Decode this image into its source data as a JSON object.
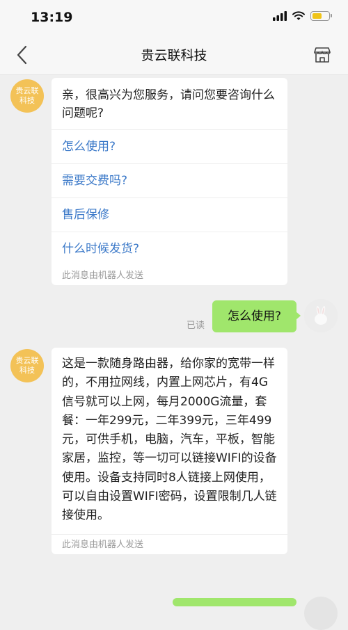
{
  "status_bar": {
    "time": "13:19"
  },
  "nav": {
    "title": "贵云联科技"
  },
  "bot": {
    "avatar_text": "贵云联\n科技"
  },
  "messages": {
    "welcome": {
      "text": "亲，很高兴为您服务，请问您要咨询什么问题呢?",
      "options": [
        "怎么使用?",
        "需要交费吗?",
        "售后保修",
        "什么时候发货?"
      ],
      "note": "此消息由机器人发送"
    },
    "user_question": {
      "text": "怎么使用?",
      "read": "已读"
    },
    "answer": {
      "text": "这是一款随身路由器，给你家的宽带一样的，不用拉网线，内置上网芯片，有4G信号就可以上网，每月2000G流量，套餐：一年299元，二年399元，三年499元，可供手机，电脑，汽车，平板，智能家居，监控，等一切可以链接WIFI的设备使用。设备支持同时8人链接上网使用，可以自由设置WIFI密码，设置限制几人链接使用。",
      "note": "此消息由机器人发送"
    }
  },
  "colors": {
    "user_bubble": "#a0e66c",
    "link": "#3a78c8",
    "bot_avatar": "#f3c257"
  }
}
